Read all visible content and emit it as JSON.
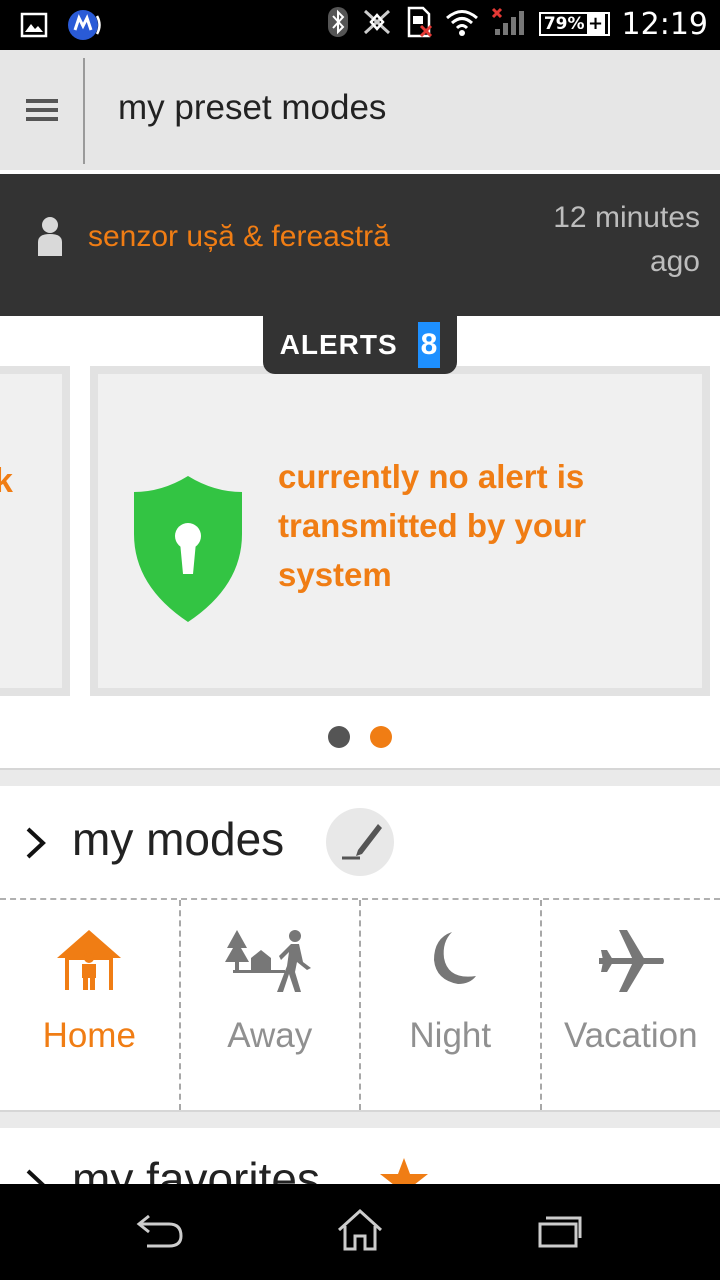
{
  "status_bar": {
    "time": "12:19",
    "battery_percent": "79%",
    "battery_plus": "+",
    "icons": [
      "image-icon",
      "app-notification-icon",
      "bluetooth-icon",
      "nfc-off-icon",
      "sim-error-icon",
      "wifi-icon",
      "signal-icon",
      "battery-icon"
    ]
  },
  "action_bar": {
    "title": "my preset modes",
    "menu_icon": "hamburger-menu-icon"
  },
  "notification": {
    "sensor_name": "senzor ușă & fereastră",
    "time_line1": "12 minutes",
    "time_line2": "ago"
  },
  "alerts": {
    "label": "ALERTS",
    "count": "8"
  },
  "alert_card": {
    "prev_card_fragment": "k",
    "message": "currently no alert is transmitted by your system"
  },
  "pager": {
    "page_count": 2,
    "active_page": 2
  },
  "modes": {
    "title": "my modes",
    "items": [
      {
        "label": "Home",
        "icon": "home-icon",
        "active": true
      },
      {
        "label": "Away",
        "icon": "away-walking-icon",
        "active": false
      },
      {
        "label": "Night",
        "icon": "moon-icon",
        "active": false
      },
      {
        "label": "Vacation",
        "icon": "airplane-icon",
        "active": false
      }
    ]
  },
  "favorites": {
    "title": "my favorites"
  },
  "colors": {
    "accent": "#f07d14",
    "dark": "#333333",
    "shield_green": "#33c443",
    "alerts_badge": "#1e90ff"
  }
}
